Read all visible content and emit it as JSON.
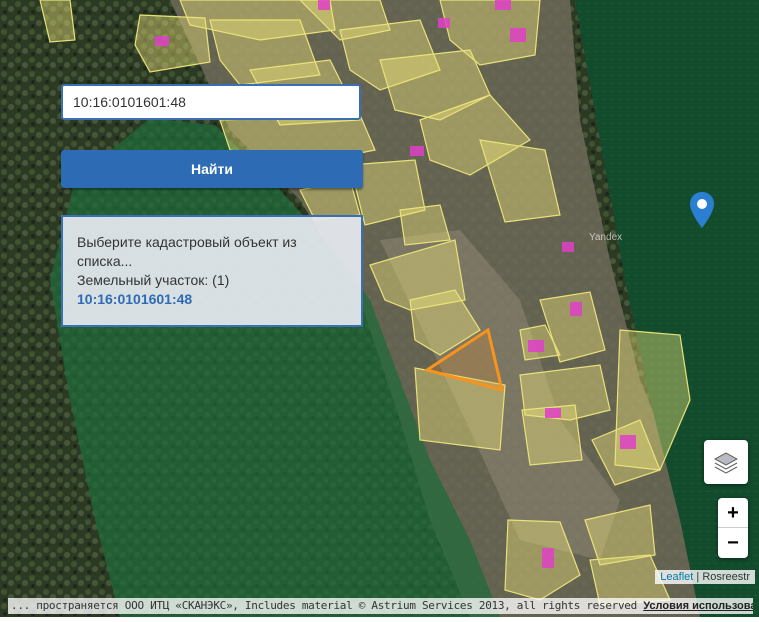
{
  "search": {
    "value": "10:16:0101601:48"
  },
  "find_button": {
    "label": "Найти"
  },
  "result": {
    "message": "Выберите кадастровый объект из списка...",
    "group_label": "Земельный участок: (1)",
    "item": "10:16:0101601:48"
  },
  "map": {
    "watermark": "Yandex",
    "colors": {
      "forest_overlay": "#1f6b3a",
      "parcel_fill": "#ebe27a",
      "parcel_stroke": "#e9e27a",
      "selected_parcel": "#f7931e",
      "building": "#e040c8",
      "marker": "#2a7fd0"
    },
    "icons": [
      "map-marker-icon",
      "layers-icon"
    ]
  },
  "zoom": {
    "in": "+",
    "out": "−"
  },
  "attribution": {
    "leaflet": "Leaflet",
    "separator": " | ",
    "provider": "Rosreestr"
  },
  "copyright": {
    "text": "... пространяется ООО ИТЦ «СКАНЭКС», Includes material © Astrium Services 2013, all rights reserved ",
    "terms": "Условия использования"
  }
}
